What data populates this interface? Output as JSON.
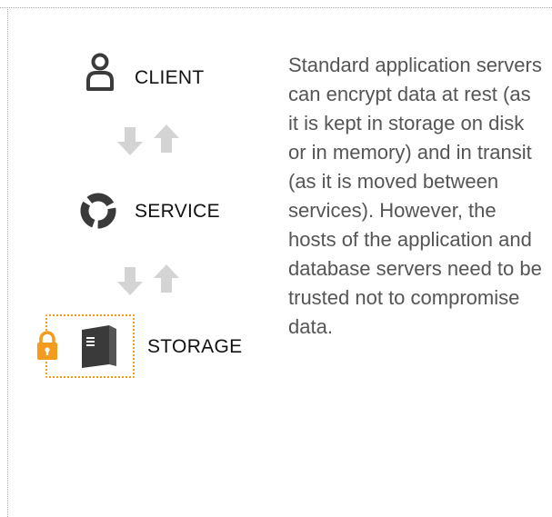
{
  "nodes": {
    "client": {
      "label": "CLIENT",
      "icon": "user-icon"
    },
    "service": {
      "label": "SERVICE",
      "icon": "service-ring-icon"
    },
    "storage": {
      "label": "STORAGE",
      "icon": "server-icon",
      "badge_icon": "lock-icon"
    }
  },
  "connectors": [
    {
      "icons": [
        "arrow-down-icon",
        "arrow-up-icon"
      ],
      "between": [
        "CLIENT",
        "SERVICE"
      ]
    },
    {
      "icons": [
        "arrow-down-icon",
        "arrow-up-icon"
      ],
      "between": [
        "SERVICE",
        "STORAGE"
      ]
    }
  ],
  "description": "Standard application servers can encrypt data at rest (as it is kept in storage on disk or in memory) and in transit (as it is moved between services). However, the hosts of the application and database servers need to be trusted not to compromise data.",
  "colors": {
    "text": "#1a1a1a",
    "description_text": "#555555",
    "arrow": "#d4d4d4",
    "lock_accent": "#f29b1d",
    "server": "#3a3a3a",
    "frame": "#a6a6a6"
  }
}
